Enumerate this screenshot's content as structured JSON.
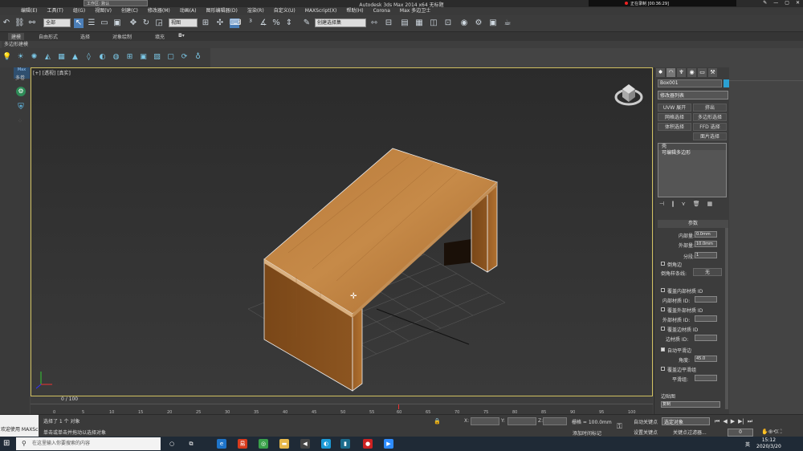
{
  "window": {
    "app_title": "Autodesk 3ds Max  2014 x64      无标题",
    "workspace": "工作区: 默认",
    "recorder_text": "正在录制 [00:36:29]",
    "controls": [
      "✎",
      "—",
      "▢",
      "✕"
    ]
  },
  "menu": [
    "编辑(E)",
    "工具(T)",
    "组(G)",
    "视图(V)",
    "创建(C)",
    "修改器(M)",
    "动画(A)",
    "图形编辑器(D)",
    "渲染(R)",
    "自定义(U)",
    "MAXScript(X)",
    "帮助(H)",
    "Corona",
    "Max 多边卫士"
  ],
  "toolbar": {
    "filter": "全部",
    "ref_coord": "视图",
    "named_sel": "创建选择集"
  },
  "ribbon_tabs": [
    "建模",
    "自由形式",
    "选择",
    "对象绘制",
    "填充"
  ],
  "ribbon_sub": "多边形建模",
  "left_panel": {
    "max_label": "Max",
    "label": "多卷"
  },
  "viewport": {
    "label": "[+] [透视] [真实]"
  },
  "time_slider": {
    "label": "0 / 100"
  },
  "timeline_ticks": [
    "0",
    "5",
    "10",
    "15",
    "20",
    "25",
    "30",
    "35",
    "40",
    "45",
    "50",
    "55",
    "60",
    "65",
    "70",
    "75",
    "80",
    "85",
    "90",
    "95",
    "100"
  ],
  "status": {
    "welcome": "欢迎使用 MAXSc",
    "line1": "选择了 1 个 对象",
    "line2": "单击或单击并拖动以选择对象",
    "x_label": "X:",
    "y_label": "Y:",
    "z_label": "Z:",
    "grid": "栅格 = 100.0mm",
    "add_tag": "添加时间标记",
    "auto_key": "自动关键点",
    "set_key": "设置关键点",
    "sel_set": "选定对象",
    "key_filter": "关键点过滤器...",
    "frame": "0",
    "play_controls": [
      "⏮",
      "◀",
      "▶",
      "▶|",
      "⏭"
    ]
  },
  "command_panel": {
    "object_name": "Box001",
    "modifier_list": "修改器列表",
    "buttons": [
      "UVW 展开",
      "挤出",
      "网格选择",
      "多边形选择",
      "体积选择",
      "FFD 选择",
      "面片选择"
    ],
    "stack": [
      "壳",
      "可编辑多边形"
    ],
    "stack_tools": [
      "⊣",
      "‖",
      "⋎",
      "🗑",
      "▦"
    ],
    "rollout": "参数",
    "inner_label": "内部量:",
    "inner_val": "0.0mm",
    "outer_label": "外部量:",
    "outer_val": "10.0mm",
    "seg_label": "分段:",
    "seg_val": "1",
    "bevel_edges": "倒角边",
    "bevel_spline": "倒角样条线:",
    "none_btn": "无",
    "override_inner": "覆盖内部材质 ID",
    "inner_id": "内部材质 ID:",
    "override_outer": "覆盖外部材质 ID",
    "outer_id": "外部材质 ID:",
    "override_edge": "覆盖边材质 ID",
    "edge_id": "边材质 ID:",
    "auto_smooth": "自动平滑边",
    "angle_label": "角度:",
    "angle_val": "45.0",
    "override_smooth": "覆盖边平滑组",
    "smooth_group": "平滑组:",
    "edge_map": "边贴图",
    "edge_map_val": "复制"
  },
  "taskbar": {
    "search": "在这里输入你要搜索的内容",
    "lang": "英",
    "time": "15:12",
    "date": "2020/3/20"
  }
}
